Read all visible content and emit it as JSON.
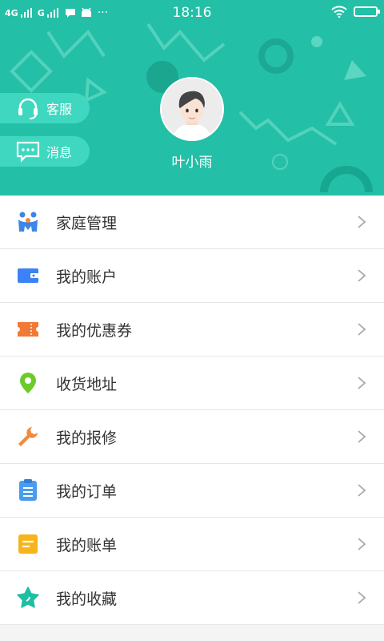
{
  "status_bar": {
    "network1": "4G",
    "network2": "G",
    "time": "18:16",
    "more": "···"
  },
  "header": {
    "background_color": "#23bfa6",
    "buttons": [
      {
        "label": "客服",
        "icon": "headset-icon"
      },
      {
        "label": "消息",
        "icon": "chat-icon"
      }
    ],
    "username": "叶小雨"
  },
  "menu": {
    "items": [
      {
        "label": "家庭管理",
        "icon": "family-icon",
        "color": "#3d86e6"
      },
      {
        "label": "我的账户",
        "icon": "wallet-icon",
        "color": "#3b82f6"
      },
      {
        "label": "我的优惠券",
        "icon": "coupon-icon",
        "color": "#f07a36"
      },
      {
        "label": "收货地址",
        "icon": "location-pin-icon",
        "color": "#6ccb2b"
      },
      {
        "label": "我的报修",
        "icon": "wrench-icon",
        "color": "#f08a3c"
      },
      {
        "label": "我的订单",
        "icon": "clipboard-icon",
        "color": "#4a9cf0"
      },
      {
        "label": "我的账单",
        "icon": "bill-icon",
        "color": "#f6b51d"
      },
      {
        "label": "我的收藏",
        "icon": "star-icon",
        "color": "#1fbfa4"
      }
    ]
  }
}
